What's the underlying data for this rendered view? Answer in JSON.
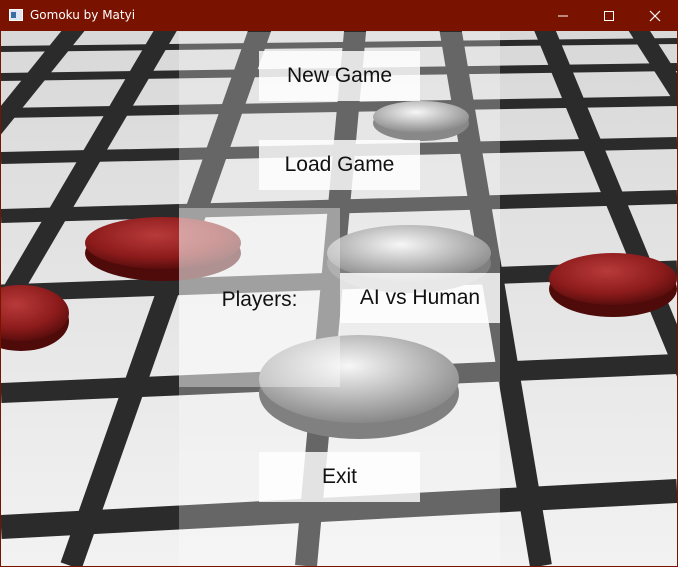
{
  "window": {
    "title": "Gomoku by Matyi",
    "minimize_icon": "minimize-icon",
    "maximize_icon": "maximize-icon",
    "close_icon": "close-icon"
  },
  "menu": {
    "new_game_label": "New Game",
    "load_game_label": "Load Game",
    "players_label": "Players:",
    "players_value": "AI vs Human",
    "exit_label": "Exit"
  },
  "colors": {
    "titlebar": "#7a1200",
    "red_piece": "#8e1c1c",
    "grid_lines": "#2b2b2b",
    "board_tiles": "#e6e6e6"
  }
}
